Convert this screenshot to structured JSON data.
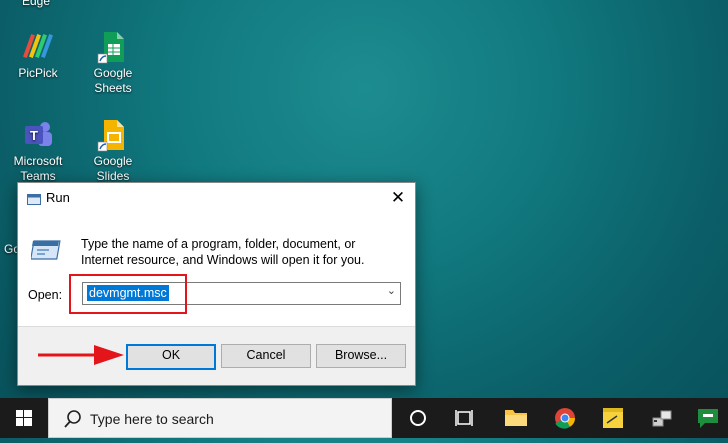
{
  "desktop": {
    "top_fragment": "Edge",
    "left_fragment": "Go",
    "icons": [
      {
        "label": "PicPick",
        "icon": "picpick-icon"
      },
      {
        "label": "Google Sheets",
        "icon": "google-sheets-icon"
      },
      {
        "label": "Microsoft Teams",
        "icon": "microsoft-teams-icon"
      },
      {
        "label": "Google Slides",
        "icon": "google-slides-icon"
      }
    ]
  },
  "run_dialog": {
    "title": "Run",
    "close_label": "✕",
    "description": "Type the name of a program, folder, document, or Internet resource, and Windows will open it for you.",
    "open_label": "Open:",
    "open_value": "devmgmt.msc",
    "buttons": {
      "ok": "OK",
      "cancel": "Cancel",
      "browse": "Browse..."
    }
  },
  "taskbar": {
    "search_placeholder": "Type here to search",
    "icons": [
      "windows-start-icon",
      "cortana-icon",
      "task-view-icon",
      "file-explorer-icon",
      "chrome-icon",
      "sticky-notes-icon",
      "network-app-icon",
      "google-chat-icon"
    ]
  },
  "colors": {
    "accent": "#0078d7",
    "highlight_box": "#e4141b",
    "taskbar": "#1b1b1b"
  }
}
